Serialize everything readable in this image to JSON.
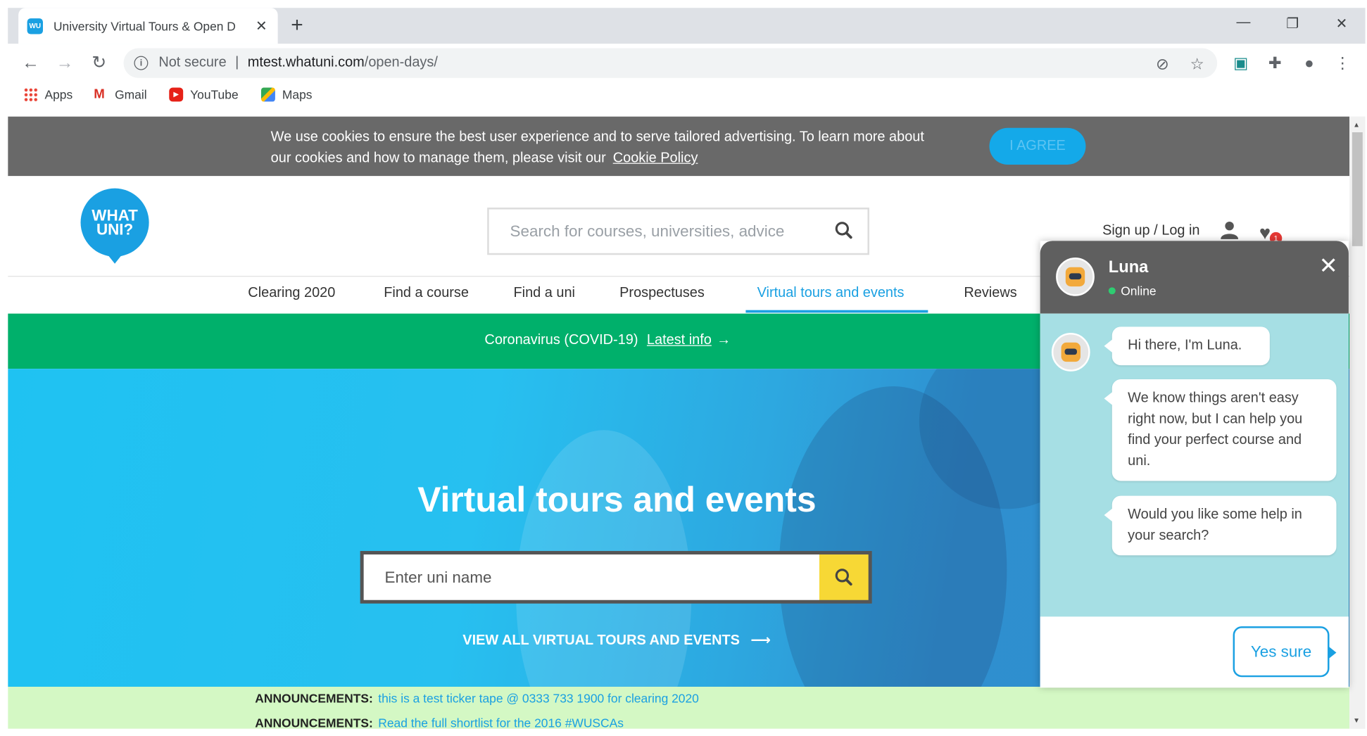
{
  "browser": {
    "tab_title": "University Virtual Tours & Open D",
    "favicon_text": "WU",
    "security_label": "Not secure",
    "url_host": "mtest.whatuni.com",
    "url_path": "/open-days/",
    "bookmarks": [
      {
        "label": "Apps",
        "icon": "apps-grid-icon"
      },
      {
        "label": "Gmail",
        "icon": "gmail-icon"
      },
      {
        "label": "YouTube",
        "icon": "youtube-icon"
      },
      {
        "label": "Maps",
        "icon": "maps-icon"
      }
    ]
  },
  "cookie_banner": {
    "text_line1": "We use cookies to ensure the best user experience and to serve tailored advertising. To learn more about",
    "text_line2": "our cookies and how to manage them, please visit our",
    "link": "Cookie Policy",
    "button": "I AGREE"
  },
  "header": {
    "logo_line1": "WHAT",
    "logo_line2": "UNI?",
    "search_placeholder": "Search for courses, universities, advice",
    "signup": "Sign up / Log in",
    "favourites_count": "1"
  },
  "nav": {
    "items": [
      "Clearing 2020",
      "Find a course",
      "Find a uni",
      "Prospectuses",
      "Virtual tours and events",
      "Reviews"
    ],
    "active": "Virtual tours and events"
  },
  "covid_banner": {
    "text": "Coronavirus (COVID-19)",
    "link": "Latest info"
  },
  "hero": {
    "title": "Virtual tours and events",
    "search_placeholder": "Enter uni name",
    "view_all": "VIEW ALL VIRTUAL TOURS AND EVENTS"
  },
  "ticker": [
    {
      "label": "ANNOUNCEMENTS:",
      "message": "this is a test ticker tape @ 0333 733 1900 for clearing 2020"
    },
    {
      "label": "ANNOUNCEMENTS:",
      "message": "Read the full shortlist for the 2016 #WUSCAs"
    }
  ],
  "chat": {
    "name": "Luna",
    "status": "Online",
    "messages": [
      "Hi there, I'm Luna.",
      "We know things aren't easy right now, but I can help you find your perfect course and uni.",
      "Would you like some help in your search?"
    ],
    "reply_button": "Yes sure"
  },
  "colors": {
    "brand_blue": "#1aa0e2",
    "covid_green": "#00b06b",
    "cookie_gray": "#696969",
    "search_yellow": "#f7d835",
    "chat_bg": "#a6dfe4",
    "ticker_bg": "#d4f8c4"
  }
}
